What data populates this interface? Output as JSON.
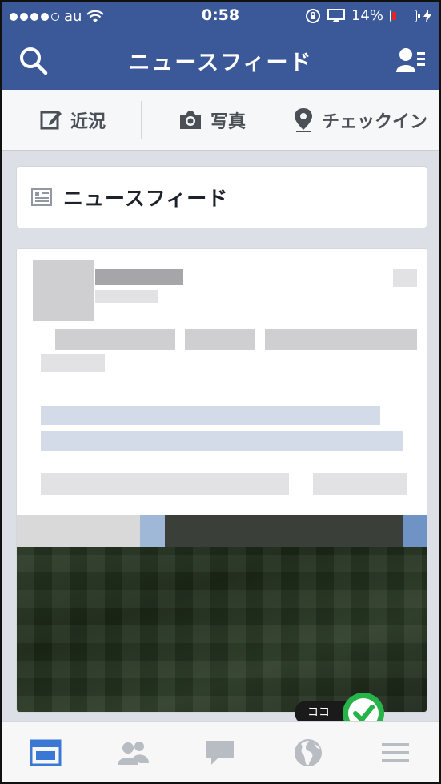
{
  "status_bar": {
    "carrier": "au",
    "time": "0:58",
    "battery": "14%"
  },
  "nav": {
    "title": "ニュースフィード",
    "search_icon": "search-icon",
    "friends_icon": "friend-requests-icon"
  },
  "composer": {
    "status_label": "近況",
    "photo_label": "写真",
    "checkin_label": "チェックイン"
  },
  "feed_header": {
    "label": "ニュースフィード",
    "icon": "news-feed-icon"
  },
  "tabbar": {
    "items": [
      "news-feed-tab-icon",
      "friends-tab-icon",
      "messages-tab-icon",
      "notifications-globe-icon",
      "menu-icon"
    ]
  },
  "annotation": {
    "callout_text": "ココ"
  },
  "colors": {
    "brand_blue": "#3b5998",
    "battery_low": "#e0252c",
    "annotation_green": "#27b34a"
  }
}
